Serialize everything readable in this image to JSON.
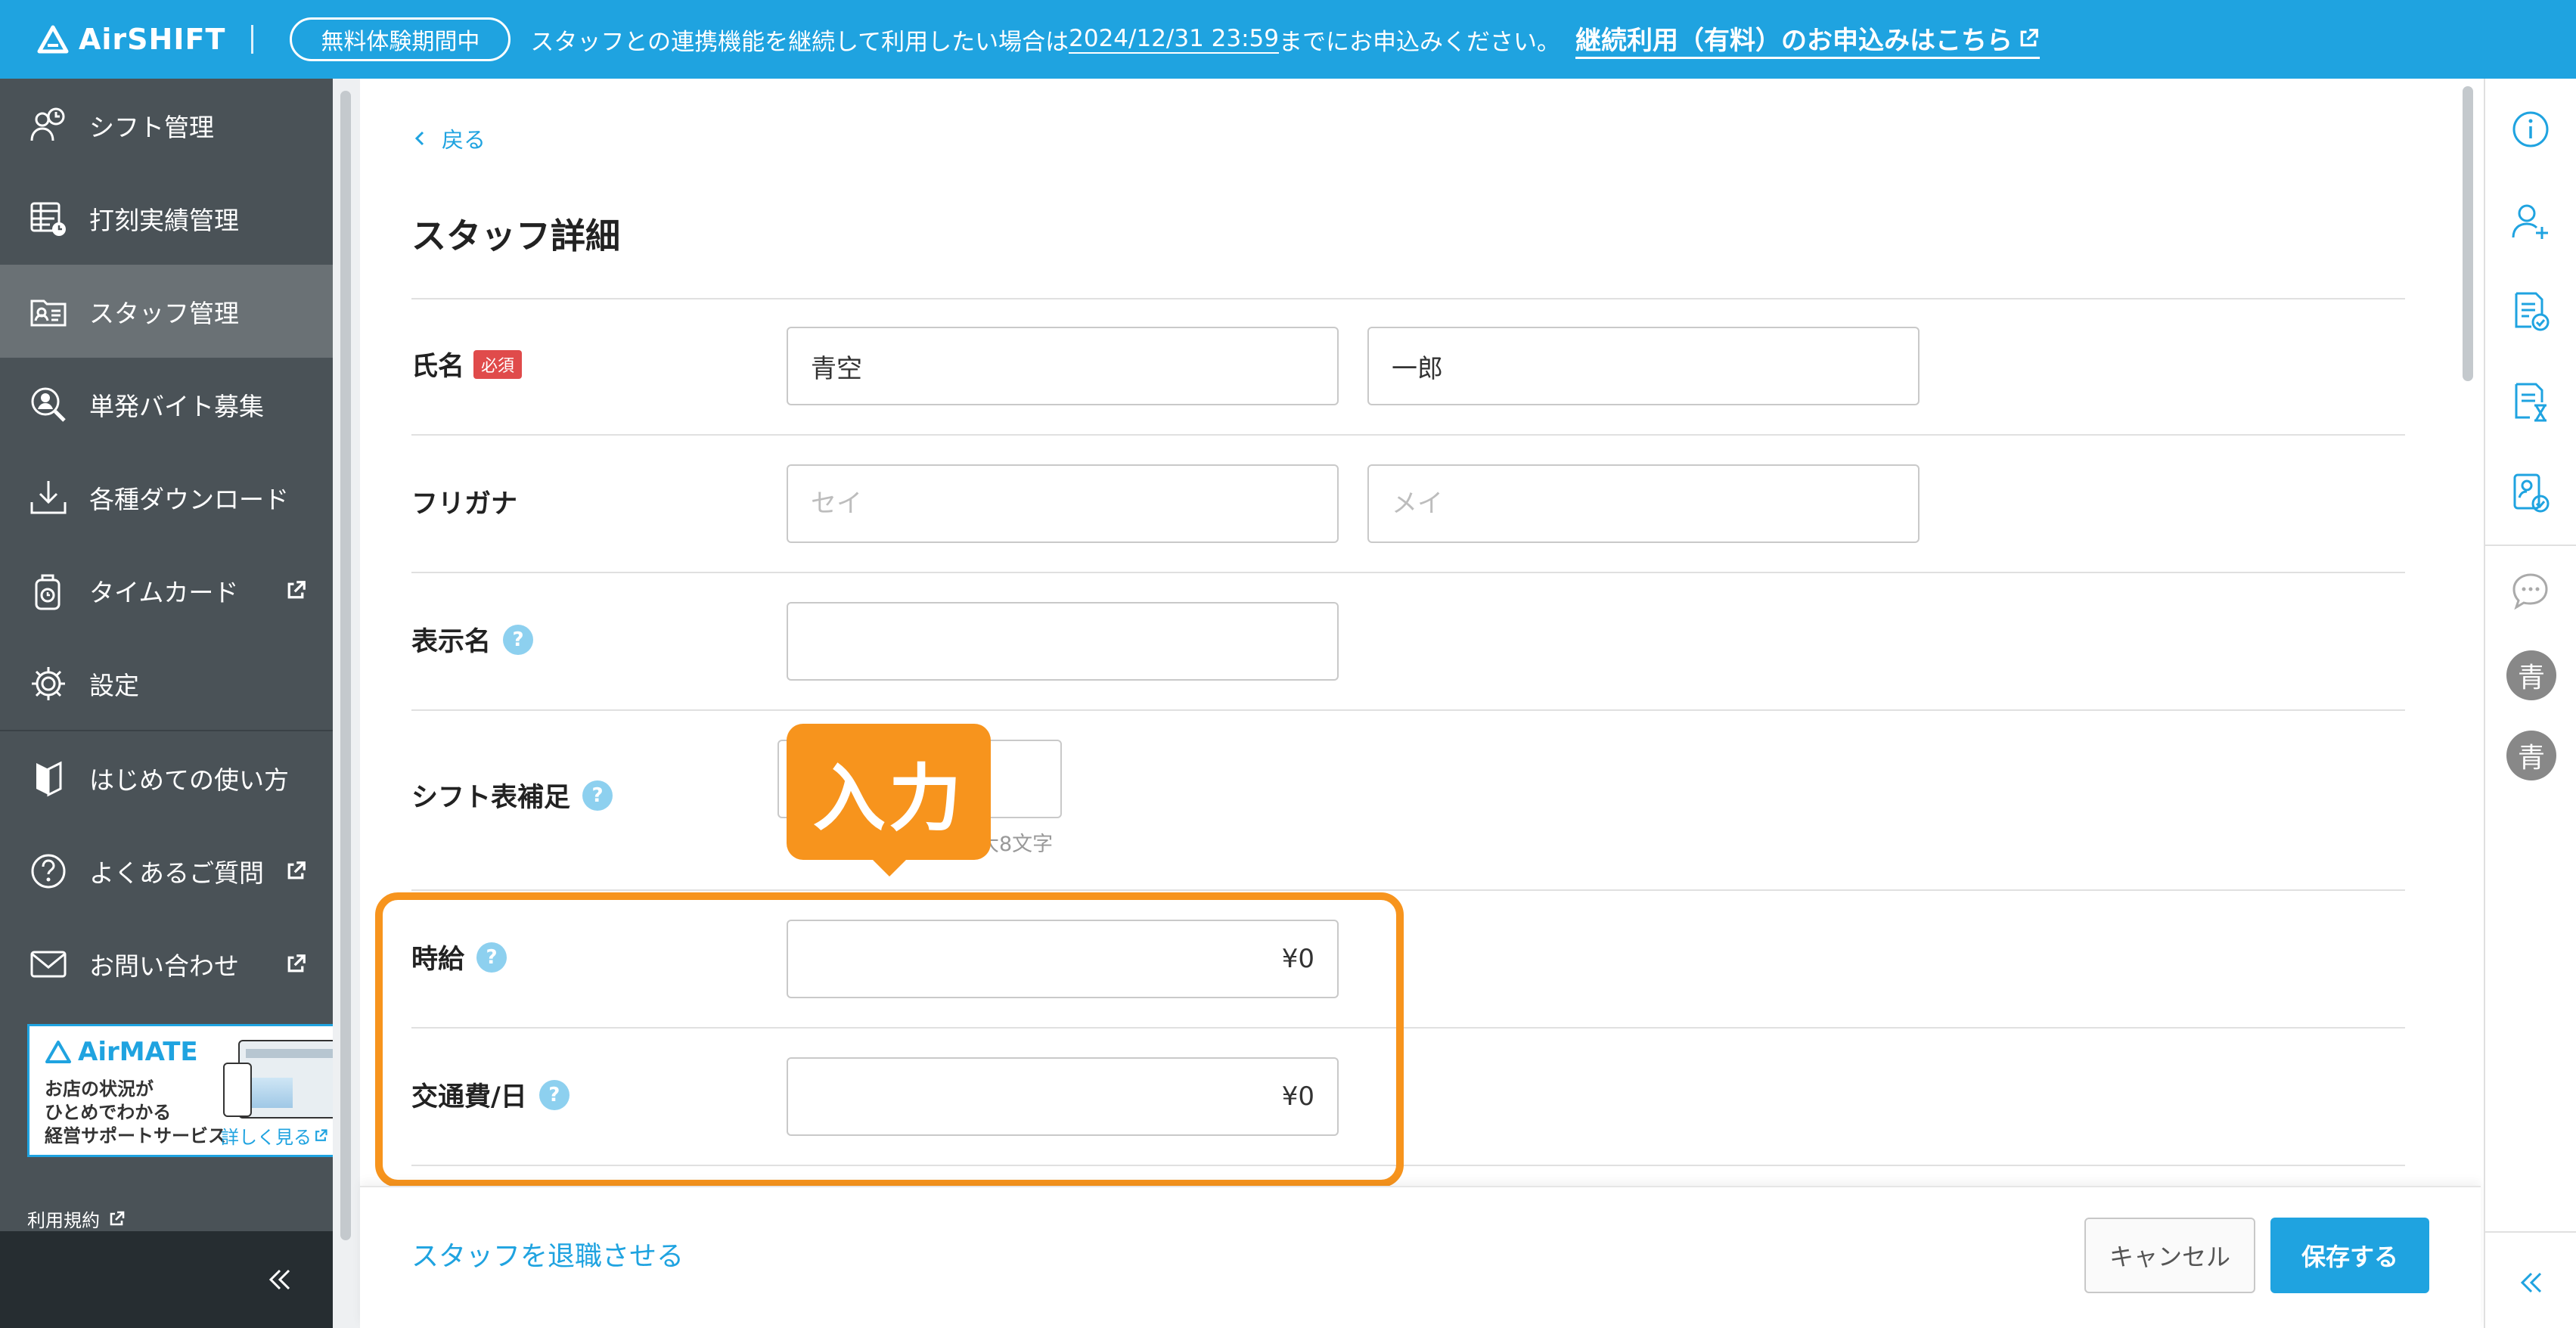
{
  "topbar": {
    "brand": "AirSHIFT",
    "trial_badge": "無料体験期間中",
    "message_before": "スタッフとの連携機能を継続して利用したい場合は",
    "deadline": "2024/12/31 23:59",
    "message_after": "までにお申込みください。",
    "apply_link": "継続利用（有料）のお申込みはこちら"
  },
  "sidebar": {
    "items": [
      {
        "label": "シフト管理",
        "icon": "shift-icon"
      },
      {
        "label": "打刻実績管理",
        "icon": "timesheet-icon"
      },
      {
        "label": "スタッフ管理",
        "icon": "staff-card-icon",
        "active": true
      },
      {
        "label": "単発バイト募集",
        "icon": "recruit-icon"
      },
      {
        "label": "各種ダウンロード",
        "icon": "download-icon"
      },
      {
        "label": "タイムカード",
        "icon": "timecard-icon",
        "external": true
      },
      {
        "label": "設定",
        "icon": "gear-icon"
      },
      {
        "label": "はじめての使い方",
        "icon": "beginner-icon"
      },
      {
        "label": "よくあるご質問",
        "icon": "question-icon",
        "external": true
      },
      {
        "label": "お問い合わせ",
        "icon": "mail-icon",
        "external": true
      }
    ],
    "ad": {
      "brand": "AirMATE",
      "text": "お店の状況が\nひとめでわかる\n経営サポートサービス",
      "more": "詳しく見る"
    },
    "terms": "利用規約"
  },
  "main": {
    "back": "戻る",
    "title": "スタッフ詳細",
    "name": {
      "label": "氏名",
      "required": "必須",
      "last": "青空",
      "first": "一郎"
    },
    "furigana": {
      "label": "フリガナ",
      "last_placeholder": "セイ",
      "first_placeholder": "メイ"
    },
    "display_name": {
      "label": "表示名",
      "value": ""
    },
    "shift_note": {
      "label": "シフト表補足",
      "max_note": "大8文字"
    },
    "hourly_wage": {
      "label": "時給",
      "value": "¥0"
    },
    "transport": {
      "label": "交通費/日",
      "value": "¥0"
    },
    "help": "?"
  },
  "callout": {
    "text": "入力"
  },
  "footer": {
    "retire": "スタッフを退職させる",
    "cancel": "キャンセル",
    "save": "保存する"
  },
  "rail": {
    "avatar1": "青",
    "avatar2": "青"
  },
  "colors": {
    "primary": "#1fa3e0",
    "sidebar": "#4a5257",
    "accent": "#f7941d",
    "required": "#e04b4b"
  }
}
